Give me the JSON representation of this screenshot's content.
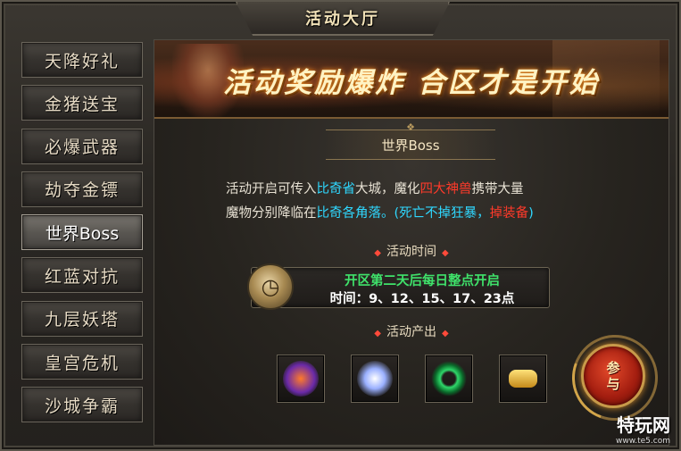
{
  "window": {
    "title": "活动大厅"
  },
  "sidebar": {
    "items": [
      {
        "label": "天降好礼",
        "active": false
      },
      {
        "label": "金猪送宝",
        "active": false
      },
      {
        "label": "必爆武器",
        "active": false
      },
      {
        "label": "劫夺金镖",
        "active": false
      },
      {
        "label": "世界Boss",
        "active": true
      },
      {
        "label": "红蓝对抗",
        "active": false
      },
      {
        "label": "九层妖塔",
        "active": false
      },
      {
        "label": "皇宫危机",
        "active": false
      },
      {
        "label": "沙城争霸",
        "active": false
      }
    ]
  },
  "banner": {
    "text": "活动奖励爆炸  合区才是开始"
  },
  "section": {
    "title": "世界Boss"
  },
  "description": {
    "line1_a": "活动开启可传入",
    "line1_b": "比奇省",
    "line1_c": "大城，魔化",
    "line1_d": "四大神兽",
    "line1_e": "携带大量",
    "line2_a": "魔物分别降临在",
    "line2_b": "比奇各角落。",
    "line2_c": "(死亡不掉狂暴，",
    "line2_d": "掉装备",
    "line2_e": ")"
  },
  "schedule": {
    "title": "活动时间",
    "line1": "开区第二天后每日整点开启",
    "line2": "时间：9、12、15、17、23点",
    "icon": "clock-icon"
  },
  "rewards": {
    "title": "活动产出",
    "items": [
      {
        "icon": "fire-orb-icon"
      },
      {
        "icon": "wing-feather-icon"
      },
      {
        "icon": "jade-ring-icon"
      },
      {
        "icon": "gold-ingot-icon"
      }
    ]
  },
  "join_button": {
    "line1": "参",
    "line2": "与"
  },
  "watermark": {
    "text": "特玩网",
    "url": "www.te5.com"
  },
  "colors": {
    "highlight_cyan": "#2fd8ff",
    "highlight_red": "#ff3a2a",
    "highlight_green": "#3fe26a",
    "title_gold": "#f2e2b8"
  }
}
